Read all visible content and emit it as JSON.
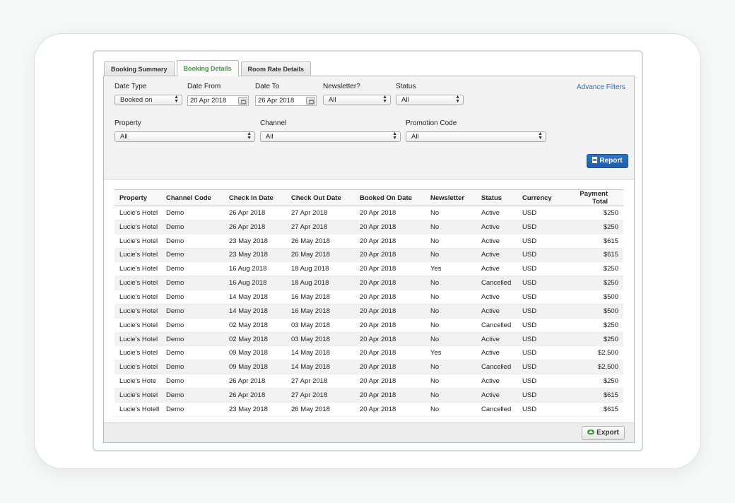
{
  "tabs": [
    "Booking Summary",
    "Booking Details",
    "Room Rate Details"
  ],
  "active_tab": "Booking Details",
  "colors": {
    "accent_green": "#3e9a3c",
    "button_blue": "#2e73c7",
    "link_blue": "#2a6ebb"
  },
  "filters": {
    "date_type": {
      "label": "Date Type",
      "value": "Booked on"
    },
    "date_from": {
      "label": "Date From",
      "value": "20 Apr 2018"
    },
    "date_to": {
      "label": "Date To",
      "value": "26 Apr 2018"
    },
    "newsletter": {
      "label": "Newsletter?",
      "value": "All"
    },
    "status": {
      "label": "Status",
      "value": "All"
    },
    "property": {
      "label": "Property",
      "value": "All"
    },
    "channel": {
      "label": "Channel",
      "value": "All"
    },
    "promotion_code": {
      "label": "Promotion Code",
      "value": "All"
    },
    "advance_filters": "Advance Filters",
    "report_button": "Report",
    "icons": {
      "select_arrows": "sort-arrows-icon",
      "calendar": "calendar-icon",
      "report": "document-icon"
    }
  },
  "table": {
    "columns": [
      "Property",
      "Channel Code",
      "Check In Date",
      "Check Out Date",
      "Booked On Date",
      "Newsletter",
      "Status",
      "Currency",
      "Payment Total"
    ],
    "rows": [
      [
        "Lucie's Hotel",
        "Demo",
        "26 Apr 2018",
        "27 Apr 2018",
        "20 Apr 2018",
        "No",
        "Active",
        "USD",
        "$250"
      ],
      [
        "Lucie's Hotel",
        "Demo",
        "26 Apr 2018",
        "27 Apr 2018",
        "20 Apr 2018",
        "No",
        "Active",
        "USD",
        "$250"
      ],
      [
        "Lucie's Hotel",
        "Demo",
        "23 May 2018",
        "26 May 2018",
        "20 Apr 2018",
        "No",
        "Active",
        "USD",
        "$615"
      ],
      [
        "Lucie's Hotel",
        "Demo",
        "23 May 2018",
        "26 May 2018",
        "20 Apr 2018",
        "No",
        "Active",
        "USD",
        "$615"
      ],
      [
        "Lucie's Hotel",
        "Demo",
        "16 Aug 2018",
        "18 Aug 2018",
        "20 Apr 2018",
        "Yes",
        "Active",
        "USD",
        "$250"
      ],
      [
        "Lucie's Hotel",
        "Demo",
        "16 Aug 2018",
        "18 Aug 2018",
        "20 Apr 2018",
        "No",
        "Cancelled",
        "USD",
        "$250"
      ],
      [
        "Lucie's Hotel",
        "Demo",
        "14 May 2018",
        "16 May 2018",
        "20 Apr 2018",
        "No",
        "Active",
        "USD",
        "$500"
      ],
      [
        "Lucie's Hotel",
        "Demo",
        "14 May 2018",
        "16 May 2018",
        "20 Apr 2018",
        "No",
        "Active",
        "USD",
        "$500"
      ],
      [
        "Lucie's Hotel",
        "Demo",
        "02 May 2018",
        "03 May 2018",
        "20 Apr 2018",
        "No",
        "Cancelled",
        "USD",
        "$250"
      ],
      [
        "Lucie's Hotel",
        "Demo",
        "02 May 2018",
        "03 May 2018",
        "20 Apr 2018",
        "No",
        "Active",
        "USD",
        "$250"
      ],
      [
        "Lucie's Hotel",
        "Demo",
        "09 May 2018",
        "14 May 2018",
        "20 Apr 2018",
        "Yes",
        "Active",
        "USD",
        "$2,500"
      ],
      [
        "Lucie's Hotel",
        "Demo",
        "09 May 2018",
        "14 May 2018",
        "20 Apr 2018",
        "No",
        "Cancelled",
        "USD",
        "$2,500"
      ],
      [
        "Lucie's Hote",
        "Demo",
        "26 Apr 2018",
        "27 Apr 2018",
        "20 Apr 2018",
        "No",
        "Active",
        "USD",
        "$250"
      ],
      [
        "Lucie's Hotel",
        "Demo",
        "26 Apr 2018",
        "27 Apr 2018",
        "20 Apr 2018",
        "No",
        "Active",
        "USD",
        "$615"
      ],
      [
        "Lucie's Hotell",
        "Demo",
        "23 May 2018",
        "26 May 2018",
        "20 Apr 2018",
        "No",
        "Cancelled",
        "USD",
        "$615"
      ]
    ]
  },
  "footer": {
    "export_button": "Export",
    "export_icon": "cloud-upload-icon"
  }
}
